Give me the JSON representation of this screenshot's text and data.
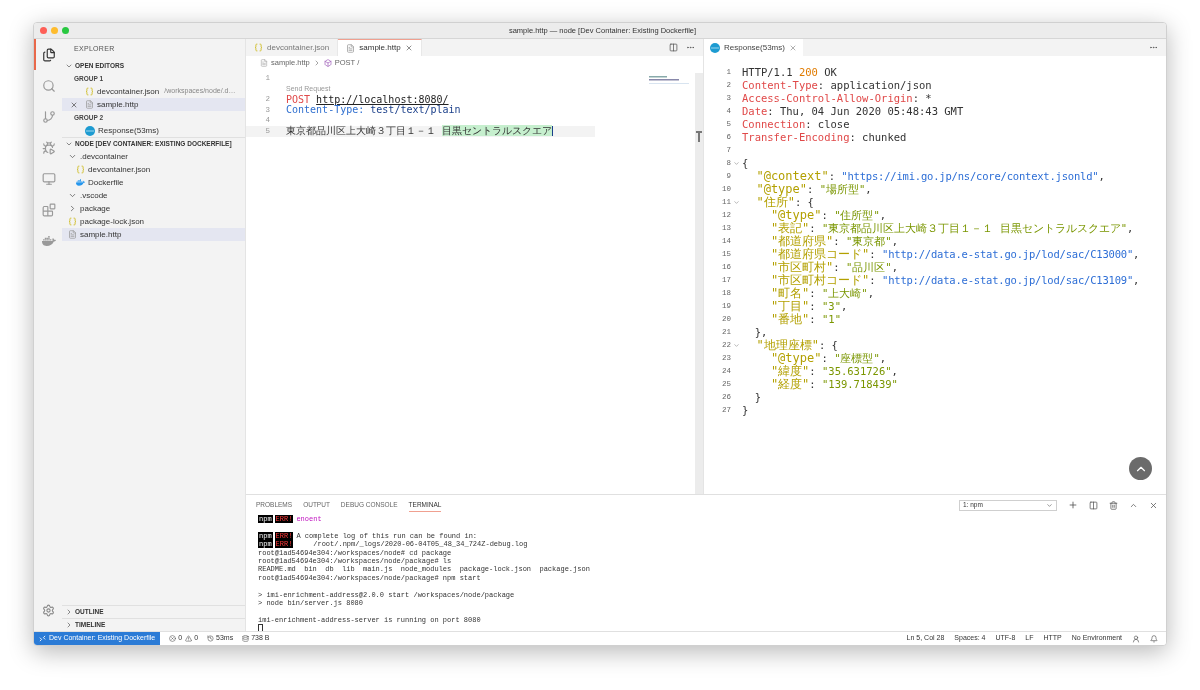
{
  "window": {
    "title": "sample.http — node [Dev Container: Existing Dockerfile]"
  },
  "activity_bar": [
    {
      "kind": "files",
      "selected": true
    },
    {
      "kind": "search",
      "selected": false
    },
    {
      "kind": "source-control",
      "selected": false
    },
    {
      "kind": "run",
      "selected": false
    },
    {
      "kind": "remote",
      "selected": false
    },
    {
      "kind": "extensions",
      "selected": false
    },
    {
      "kind": "docker",
      "selected": false
    }
  ],
  "sidebar": {
    "title": "EXPLORER",
    "open_editors": {
      "title": "OPEN EDITORS",
      "expanded": true,
      "groups": [
        {
          "title": "GROUP 1",
          "items": [
            {
              "name": "devcontainer.json",
              "path": "/workspaces/node/.d…",
              "kind": "json",
              "selected": false,
              "close_visible": false
            },
            {
              "name": "sample.http",
              "kind": "http",
              "selected": true,
              "close_visible": true
            }
          ]
        },
        {
          "title": "GROUP 2",
          "items": [
            {
              "name": "Response(53ms)",
              "kind": "response",
              "selected": false,
              "close_visible": false
            }
          ]
        }
      ]
    },
    "workspace": {
      "title": "NODE [DEV CONTAINER: EXISTING DOCKERFILE]",
      "expanded": true,
      "items": [
        {
          "name": ".devcontainer",
          "kind": "folder",
          "expanded": true,
          "selected": false,
          "children": [
            {
              "name": "devcontainer.json",
              "kind": "json",
              "selected": false
            },
            {
              "name": "Dockerfile",
              "kind": "docker",
              "selected": false
            }
          ]
        },
        {
          "name": ".vscode",
          "kind": "folder",
          "expanded": true,
          "selected": false
        },
        {
          "name": "package",
          "kind": "folder",
          "expanded": false,
          "selected": false
        },
        {
          "name": "package-lock.json",
          "kind": "json",
          "selected": false
        },
        {
          "name": "sample.http",
          "kind": "http",
          "selected": true
        }
      ]
    },
    "bottom_sections": [
      {
        "title": "OUTLINE",
        "expanded": false
      },
      {
        "title": "TIMELINE",
        "expanded": false
      }
    ]
  },
  "editor": {
    "tabs": [
      {
        "label": "devcontainer.json",
        "kind": "json",
        "selected": false
      },
      {
        "label": "sample.http",
        "kind": "http",
        "selected": true
      }
    ],
    "breadcrumb": [
      "sample.http",
      "POST /"
    ],
    "lines": [
      {
        "kind": "code",
        "number": "1"
      },
      {
        "kind": "codelens",
        "text": "Send Request"
      },
      {
        "kind": "code",
        "number": "2",
        "tokens": [
          {
            "t": "POST ",
            "kind": "method"
          },
          {
            "t": "http://localhost:8080/",
            "kind": "link"
          }
        ]
      },
      {
        "kind": "code",
        "number": "3",
        "tokens": [
          {
            "t": "Content-Type:",
            "kind": "field"
          },
          {
            "t": " test/text/plain",
            "kind": "value"
          }
        ]
      },
      {
        "kind": "code",
        "number": "4"
      },
      {
        "kind": "code",
        "number": "5",
        "highlighted": true,
        "cursor": true,
        "tokens": [
          {
            "t": "東京都品川区上大崎３丁目１－１ ",
            "kind": "plain"
          },
          {
            "t": "目黒セントラルスクエア",
            "kind": "selection"
          }
        ]
      }
    ]
  },
  "response": {
    "tab": {
      "label": "Response(53ms)",
      "selected": true
    },
    "lines": [
      {
        "number": "1",
        "tokens": [
          {
            "t": "HTTP/1.1 ",
            "kind": "plain"
          },
          {
            "t": "200",
            "kind": "status"
          },
          {
            "t": " OK",
            "kind": "plain"
          }
        ]
      },
      {
        "number": "2",
        "tokens": [
          {
            "t": "Content-Type",
            "kind": "header"
          },
          {
            "t": ": application/json",
            "kind": "plain"
          }
        ]
      },
      {
        "number": "3",
        "tokens": [
          {
            "t": "Access-Control-Allow-Origin",
            "kind": "header"
          },
          {
            "t": ": *",
            "kind": "plain"
          }
        ]
      },
      {
        "number": "4",
        "tokens": [
          {
            "t": "Date",
            "kind": "header"
          },
          {
            "t": ": Thu, 04 Jun 2020 05:48:43 GMT",
            "kind": "plain"
          }
        ]
      },
      {
        "number": "5",
        "tokens": [
          {
            "t": "Connection",
            "kind": "header"
          },
          {
            "t": ": close",
            "kind": "plain"
          }
        ]
      },
      {
        "number": "6",
        "tokens": [
          {
            "t": "Transfer-Encoding",
            "kind": "header"
          },
          {
            "t": ": chunked",
            "kind": "plain"
          }
        ]
      },
      {
        "number": "7"
      },
      {
        "number": "8",
        "expanded": true,
        "tokens": [
          {
            "t": "{",
            "kind": "plain"
          }
        ]
      },
      {
        "number": "9",
        "tokens": [
          {
            "t": "  \"@context\"",
            "kind": "key"
          },
          {
            "t": ": ",
            "kind": "plain"
          },
          {
            "t": "\"https://imi.go.jp/ns/core/context.jsonld\"",
            "kind": "url"
          },
          {
            "t": ",",
            "kind": "plain"
          }
        ]
      },
      {
        "number": "10",
        "tokens": [
          {
            "t": "  \"@type\"",
            "kind": "key"
          },
          {
            "t": ": ",
            "kind": "plain"
          },
          {
            "t": "\"場所型\"",
            "kind": "string"
          },
          {
            "t": ",",
            "kind": "plain"
          }
        ]
      },
      {
        "number": "11",
        "expanded": true,
        "tokens": [
          {
            "t": "  \"住所\"",
            "kind": "key"
          },
          {
            "t": ": {",
            "kind": "plain"
          }
        ]
      },
      {
        "number": "12",
        "tokens": [
          {
            "t": "    \"@type\"",
            "kind": "key"
          },
          {
            "t": ": ",
            "kind": "plain"
          },
          {
            "t": "\"住所型\"",
            "kind": "string"
          },
          {
            "t": ",",
            "kind": "plain"
          }
        ]
      },
      {
        "number": "13",
        "tokens": [
          {
            "t": "    \"表記\"",
            "kind": "key"
          },
          {
            "t": ": ",
            "kind": "plain"
          },
          {
            "t": "\"東京都品川区上大崎３丁目１－１ 目黒セントラルスクエア\"",
            "kind": "string"
          },
          {
            "t": ",",
            "kind": "plain"
          }
        ]
      },
      {
        "number": "14",
        "tokens": [
          {
            "t": "    \"都道府県\"",
            "kind": "key"
          },
          {
            "t": ": ",
            "kind": "plain"
          },
          {
            "t": "\"東京都\"",
            "kind": "string"
          },
          {
            "t": ",",
            "kind": "plain"
          }
        ]
      },
      {
        "number": "15",
        "tokens": [
          {
            "t": "    \"都道府県コード\"",
            "kind": "key"
          },
          {
            "t": ": ",
            "kind": "plain"
          },
          {
            "t": "\"http://data.e-stat.go.jp/lod/sac/C13000\"",
            "kind": "url"
          },
          {
            "t": ",",
            "kind": "plain"
          }
        ]
      },
      {
        "number": "16",
        "tokens": [
          {
            "t": "    \"市区町村\"",
            "kind": "key"
          },
          {
            "t": ": ",
            "kind": "plain"
          },
          {
            "t": "\"品川区\"",
            "kind": "string"
          },
          {
            "t": ",",
            "kind": "plain"
          }
        ]
      },
      {
        "number": "17",
        "tokens": [
          {
            "t": "    \"市区町村コード\"",
            "kind": "key"
          },
          {
            "t": ": ",
            "kind": "plain"
          },
          {
            "t": "\"http://data.e-stat.go.jp/lod/sac/C13109\"",
            "kind": "url"
          },
          {
            "t": ",",
            "kind": "plain"
          }
        ]
      },
      {
        "number": "18",
        "tokens": [
          {
            "t": "    \"町名\"",
            "kind": "key"
          },
          {
            "t": ": ",
            "kind": "plain"
          },
          {
            "t": "\"上大崎\"",
            "kind": "string"
          },
          {
            "t": ",",
            "kind": "plain"
          }
        ]
      },
      {
        "number": "19",
        "tokens": [
          {
            "t": "    \"丁目\"",
            "kind": "key"
          },
          {
            "t": ": ",
            "kind": "plain"
          },
          {
            "t": "\"3\"",
            "kind": "string"
          },
          {
            "t": ",",
            "kind": "plain"
          }
        ]
      },
      {
        "number": "20",
        "tokens": [
          {
            "t": "    \"番地\"",
            "kind": "key"
          },
          {
            "t": ": ",
            "kind": "plain"
          },
          {
            "t": "\"1\"",
            "kind": "string"
          }
        ]
      },
      {
        "number": "21",
        "tokens": [
          {
            "t": "  },",
            "kind": "plain"
          }
        ]
      },
      {
        "number": "22",
        "expanded": true,
        "tokens": [
          {
            "t": "  \"地理座標\"",
            "kind": "key"
          },
          {
            "t": ": {",
            "kind": "plain"
          }
        ]
      },
      {
        "number": "23",
        "tokens": [
          {
            "t": "    \"@type\"",
            "kind": "key"
          },
          {
            "t": ": ",
            "kind": "plain"
          },
          {
            "t": "\"座標型\"",
            "kind": "string"
          },
          {
            "t": ",",
            "kind": "plain"
          }
        ]
      },
      {
        "number": "24",
        "tokens": [
          {
            "t": "    \"緯度\"",
            "kind": "key"
          },
          {
            "t": ": ",
            "kind": "plain"
          },
          {
            "t": "\"35.631726\"",
            "kind": "string"
          },
          {
            "t": ",",
            "kind": "plain"
          }
        ]
      },
      {
        "number": "25",
        "tokens": [
          {
            "t": "    \"経度\"",
            "kind": "key"
          },
          {
            "t": ": ",
            "kind": "plain"
          },
          {
            "t": "\"139.718439\"",
            "kind": "string"
          }
        ]
      },
      {
        "number": "26",
        "tokens": [
          {
            "t": "  }",
            "kind": "plain"
          }
        ]
      },
      {
        "number": "27",
        "tokens": [
          {
            "t": "}",
            "kind": "plain"
          }
        ]
      }
    ]
  },
  "panel": {
    "tabs": [
      {
        "label": "PROBLEMS",
        "selected": false
      },
      {
        "label": "OUTPUT",
        "selected": false
      },
      {
        "label": "DEBUG CONSOLE",
        "selected": false
      },
      {
        "label": "TERMINAL",
        "selected": true
      }
    ],
    "terminal_select": "1: npm",
    "terminal_lines": [
      {
        "kind": "output",
        "tokens": [
          {
            "t": "npm",
            "kind": "npm"
          },
          {
            "t": "ERR!",
            "kind": "err"
          },
          {
            "t": "enoent",
            "kind": "code"
          }
        ]
      },
      {
        "kind": "blank"
      },
      {
        "kind": "output",
        "tokens": [
          {
            "t": "npm",
            "kind": "npm"
          },
          {
            "t": "ERR!",
            "kind": "err"
          },
          {
            "t": "A complete log of this run can be found in:",
            "kind": "plain"
          }
        ]
      },
      {
        "kind": "output",
        "tokens": [
          {
            "t": "npm",
            "kind": "npm"
          },
          {
            "t": "ERR!",
            "kind": "err"
          },
          {
            "t": "    /root/.npm/_logs/2020-06-04T05_48_34_724Z-debug.log",
            "kind": "plain"
          }
        ]
      },
      {
        "kind": "output",
        "tokens": [
          {
            "t": "root@1ad54694e304:/workspaces/node# cd package",
            "kind": "plain"
          }
        ]
      },
      {
        "kind": "output",
        "tokens": [
          {
            "t": "root@1ad54694e304:/workspaces/node/package# ls",
            "kind": "plain"
          }
        ]
      },
      {
        "kind": "output",
        "tokens": [
          {
            "t": "README.md  bin  db  lib  main.js  node_modules  package-lock.json  package.json",
            "kind": "plain"
          }
        ]
      },
      {
        "kind": "output",
        "tokens": [
          {
            "t": "root@1ad54694e304:/workspaces/node/package# npm start",
            "kind": "plain"
          }
        ]
      },
      {
        "kind": "blank"
      },
      {
        "kind": "output",
        "tokens": [
          {
            "t": "> imi-enrichment-address@2.0.0 start /workspaces/node/package",
            "kind": "plain"
          }
        ]
      },
      {
        "kind": "output",
        "tokens": [
          {
            "t": "> node bin/server.js 8080",
            "kind": "plain"
          }
        ]
      },
      {
        "kind": "blank"
      },
      {
        "kind": "output",
        "tokens": [
          {
            "t": "imi-enrichment-address-server is running on port 8080",
            "kind": "plain"
          }
        ]
      },
      {
        "kind": "cursor"
      }
    ]
  },
  "status_bar": {
    "remote": "Dev Container: Existing Dockerfile",
    "left": [
      {
        "kind": "errors",
        "text": "0"
      },
      {
        "kind": "warnings",
        "text": "0"
      },
      {
        "kind": "history",
        "text": "53ms"
      },
      {
        "kind": "database",
        "text": "738 B"
      }
    ],
    "right": [
      "Ln 5, Col 28",
      "Spaces: 4",
      "UTF-8",
      "LF",
      "HTTP",
      "No Environment"
    ]
  }
}
